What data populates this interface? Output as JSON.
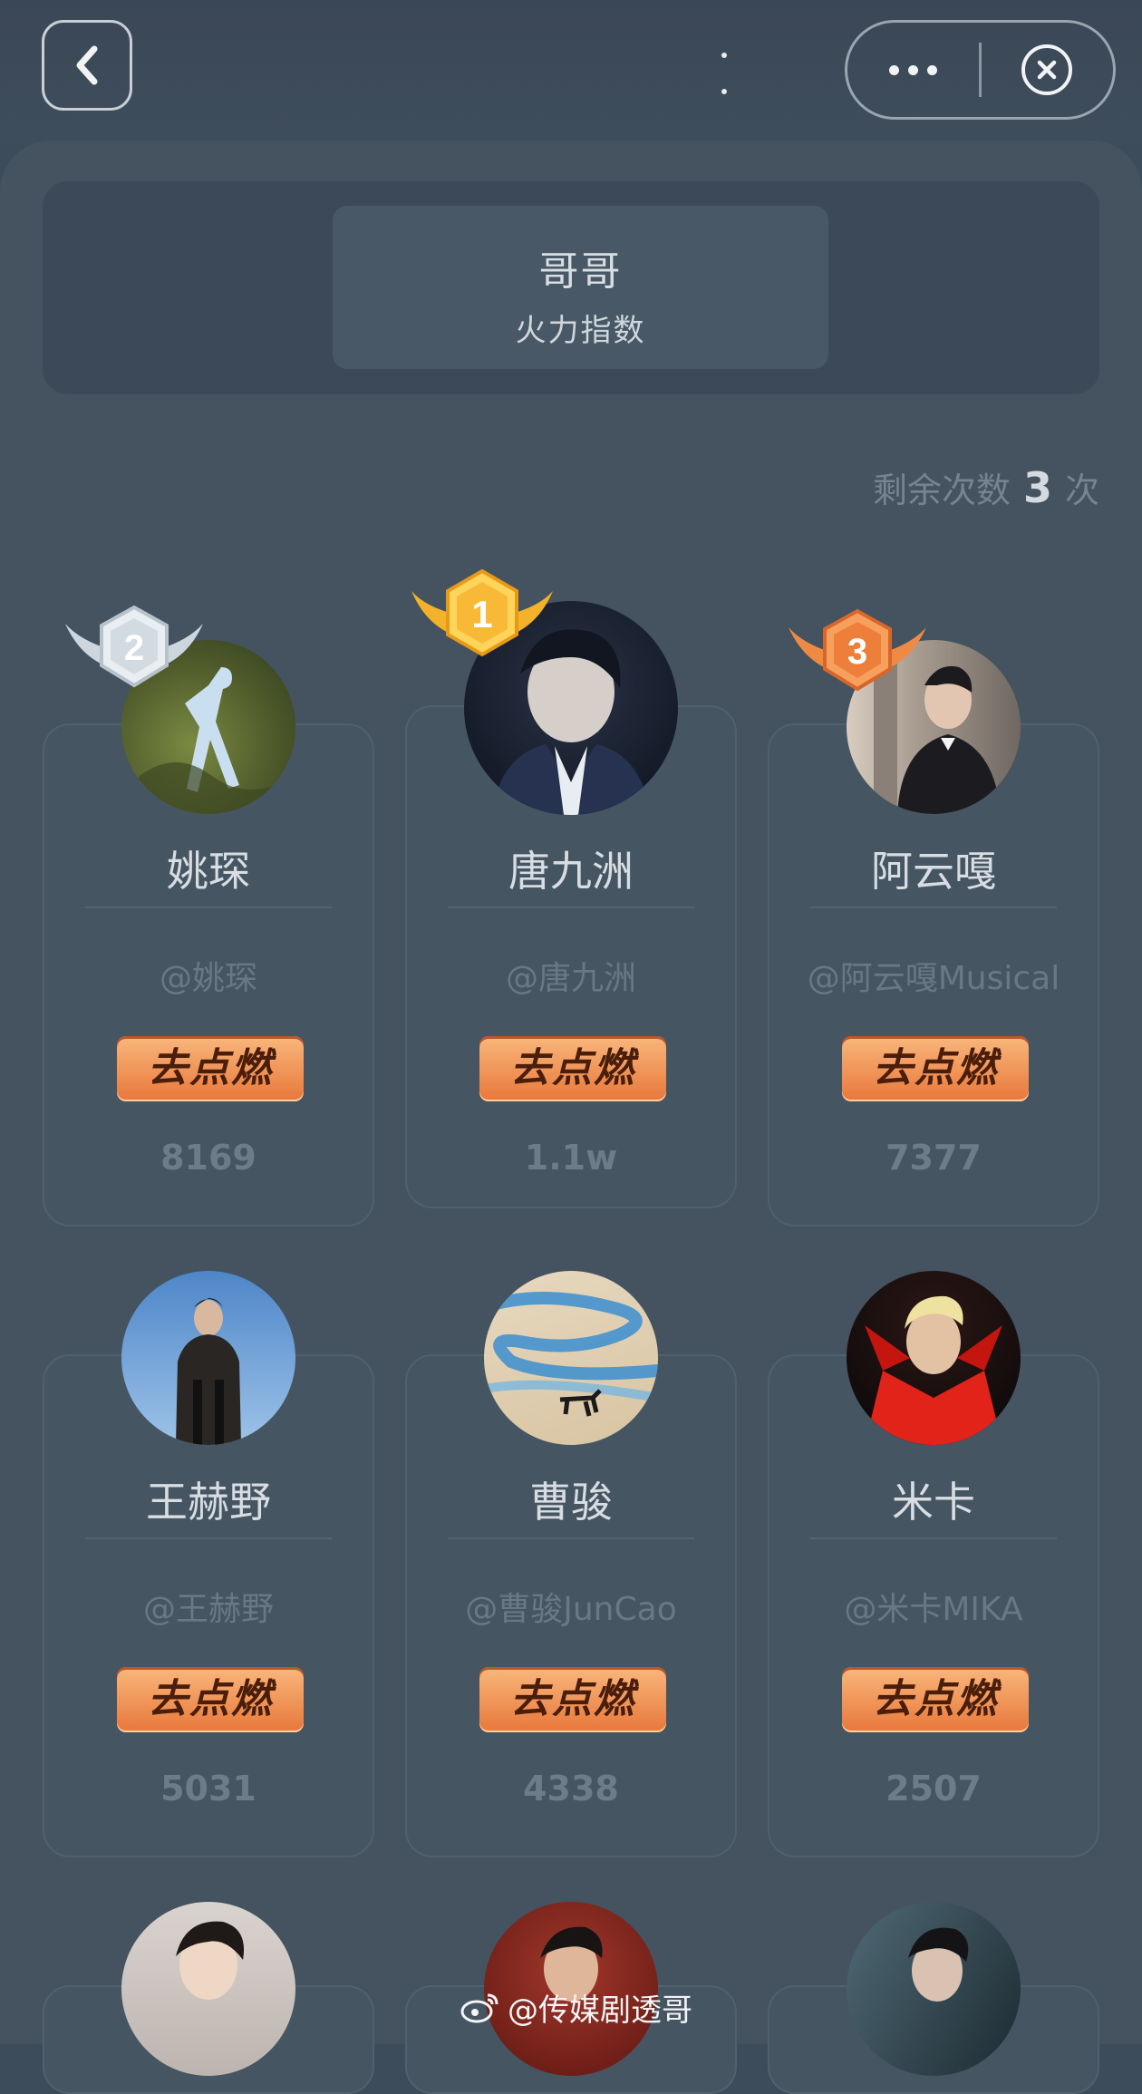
{
  "header": {
    "title": "哥哥",
    "subtitle": "火力指数"
  },
  "remaining": {
    "prefix": "剩余次数",
    "count": "3",
    "suffix": "次"
  },
  "button_label": "去点燃",
  "ranks": {
    "first": "1",
    "second": "2",
    "third": "3"
  },
  "cards": [
    {
      "name": "姚琛",
      "handle": "@姚琛",
      "score": "8169"
    },
    {
      "name": "唐九洲",
      "handle": "@唐九洲",
      "score": "1.1w"
    },
    {
      "name": "阿云嘎",
      "handle": "@阿云嘎Musical",
      "score": "7377"
    },
    {
      "name": "王赫野",
      "handle": "@王赫野",
      "score": "5031"
    },
    {
      "name": "曹骏",
      "handle": "@曹骏JunCao",
      "score": "4338"
    },
    {
      "name": "米卡",
      "handle": "@米卡MIKA",
      "score": "2507"
    }
  ],
  "watermark": "@传媒剧透哥",
  "colors": {
    "background": "#44535f",
    "button_gradient_top": "#f9b77c",
    "button_gradient_bottom": "#e8773a",
    "gold": "#f5a623",
    "silver": "#cfd8e0",
    "bronze": "#ef7d3c"
  },
  "icons": {
    "back": "chevron-left-icon",
    "more": "more-dots-icon",
    "close": "close-circle-icon",
    "watermark": "weibo-icon"
  }
}
